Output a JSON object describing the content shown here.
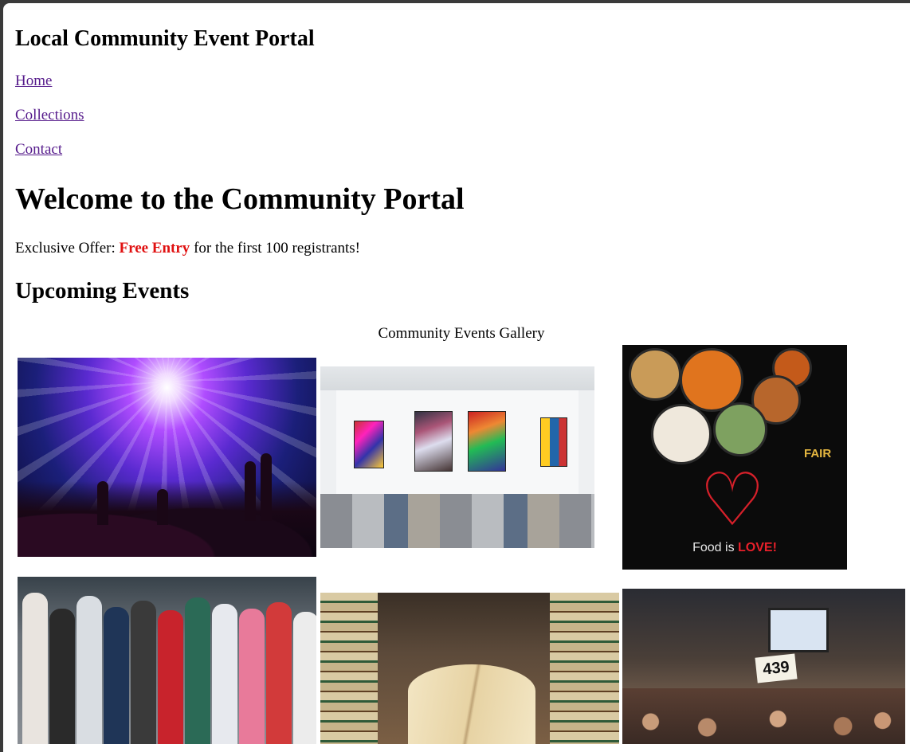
{
  "site": {
    "title": "Local Community Event Portal"
  },
  "nav": {
    "items": [
      {
        "label": "Home"
      },
      {
        "label": "Collections"
      },
      {
        "label": "Contact"
      }
    ]
  },
  "hero": {
    "title": "Welcome to the Community Portal"
  },
  "offer": {
    "prefix": "Exclusive Offer: ",
    "highlight": "Free Entry",
    "suffix": " for the first 100 registrants!",
    "highlight_color": "#e01010"
  },
  "events": {
    "heading": "Upcoming Events",
    "caption": "Community Events Gallery",
    "images": [
      {
        "subject": "concert-crowd-stage-lights"
      },
      {
        "subject": "art-gallery-room"
      },
      {
        "subject": "food-fair-poster",
        "poster_text": "Food is ",
        "poster_emphasis": "LOVE!",
        "badge_text": "FAIR"
      },
      {
        "subject": "marathon-runners"
      },
      {
        "subject": "open-book-with-stacks"
      },
      {
        "subject": "banquet-hall-auction",
        "paddle_number": "439"
      }
    ]
  },
  "colors": {
    "link": "#551a8b",
    "accent": "#e01010",
    "page_background": "#ffffff"
  }
}
